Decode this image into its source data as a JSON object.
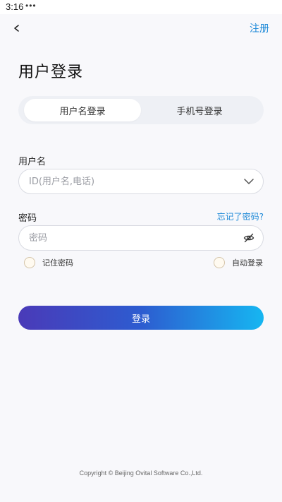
{
  "status_bar": {
    "time": "3:16",
    "dots": "•••"
  },
  "header": {
    "back_icon": "chevron-left-icon",
    "register_label": "注册"
  },
  "page": {
    "title": "用户登录"
  },
  "tabs": [
    {
      "label": "用户名登录",
      "selected": true
    },
    {
      "label": "手机号登录",
      "selected": false
    }
  ],
  "username": {
    "label": "用户名",
    "placeholder": "ID(用户名,电话)",
    "value": "",
    "dropdown_icon": "chevron-down-icon"
  },
  "password": {
    "label": "密码",
    "forgot_label": "忘记了密码?",
    "placeholder": "密码",
    "value": "",
    "visibility_icon": "eye-slash-icon"
  },
  "options": {
    "remember_label": "记住密码",
    "remember_checked": false,
    "auto_login_label": "自动登录",
    "auto_login_checked": false
  },
  "login_button": {
    "label": "登录"
  },
  "footer": {
    "copyright": "Copyright © Beijing Ovital Software Co.,Ltd."
  },
  "colors": {
    "accent": "#1f8ad8",
    "gradient_start": "#4a3ab8",
    "gradient_end": "#16b6f1",
    "background": "#f8f8fb"
  }
}
